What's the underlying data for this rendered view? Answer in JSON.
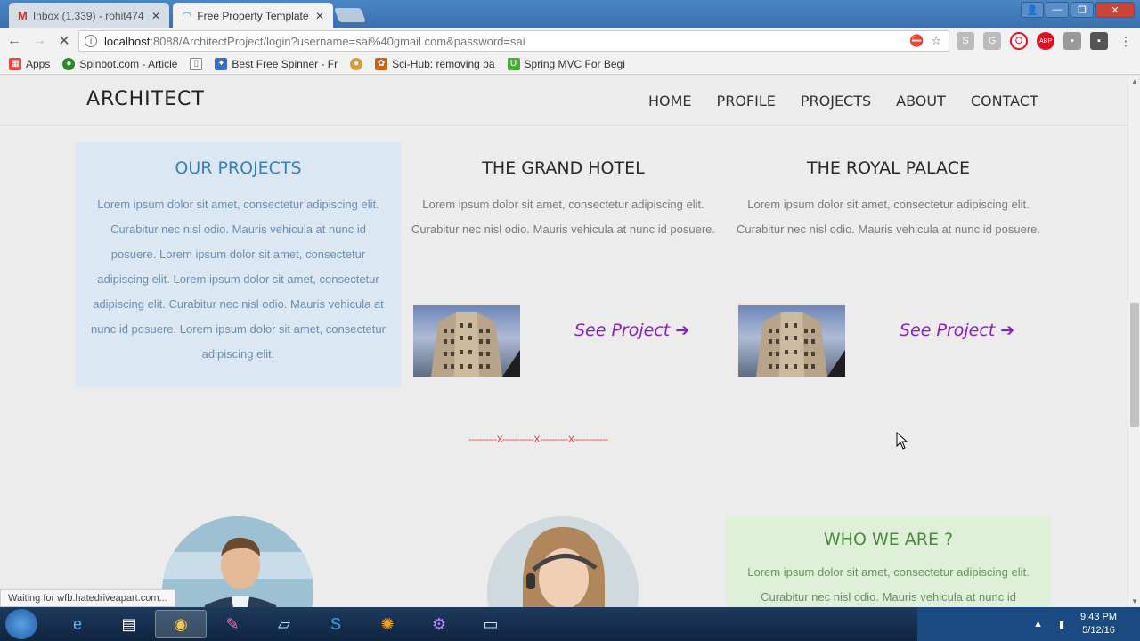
{
  "browser": {
    "tabs": [
      {
        "label": "Inbox (1,339) - rohit474",
        "icon": "gmail-icon"
      },
      {
        "label": "Free Property Template",
        "icon": "loading-icon"
      }
    ],
    "url_host": "localhost",
    "url_path": ":8088/ArchitectProject/login?username=sai%40gmail.com&password=sai",
    "bookmarks": [
      {
        "label": "Apps"
      },
      {
        "label": "Spinbot.com - Article"
      },
      {
        "label": "Best Free Spinner - Fr"
      },
      {
        "label": "Sci-Hub: removing ba"
      },
      {
        "label": "Spring MVC For Begi"
      }
    ],
    "status_text": "Waiting for wfb.hatedriveapart.com..."
  },
  "site": {
    "logo": "ARCHITECT",
    "nav": [
      "HOME",
      "PROFILE",
      "PROJECTS",
      "ABOUT",
      "CONTACT"
    ],
    "our_projects": {
      "title": "OUR PROJECTS",
      "text": "Lorem ipsum dolor sit amet, consectetur adipiscing elit. Curabitur nec nisl odio. Mauris vehicula at nunc id posuere. Lorem ipsum dolor sit amet, consectetur adipiscing elit. Lorem ipsum dolor sit amet, consectetur adipiscing elit. Curabitur nec nisl odio. Mauris vehicula at nunc id posuere. Lorem ipsum dolor sit amet, consectetur adipiscing elit."
    },
    "projects": [
      {
        "title": "THE GRAND HOTEL",
        "text": "Lorem ipsum dolor sit amet, consectetur adipiscing elit. Curabitur nec nisl odio. Mauris vehicula at nunc id posuere.",
        "link": "See Project"
      },
      {
        "title": "THE ROYAL PALACE",
        "text": "Lorem ipsum dolor sit amet, consectetur adipiscing elit. Curabitur nec nisl odio. Mauris vehicula at nunc id posuere.",
        "link": "See Project"
      }
    ],
    "divider": "----------X-----------X----------X------------",
    "who": {
      "title": "WHO WE ARE ?",
      "text": "Lorem ipsum dolor sit amet, consectetur adipiscing elit. Curabitur nec nisl odio. Mauris vehicula at nunc id"
    }
  },
  "taskbar": {
    "time": "9:43 PM",
    "date": "5/12/16"
  },
  "colors": {
    "accent_blue": "#3a7fb8",
    "link_purple": "#8b1fbf",
    "divider_red": "#e03b3b",
    "who_green": "#4a8a3e"
  }
}
